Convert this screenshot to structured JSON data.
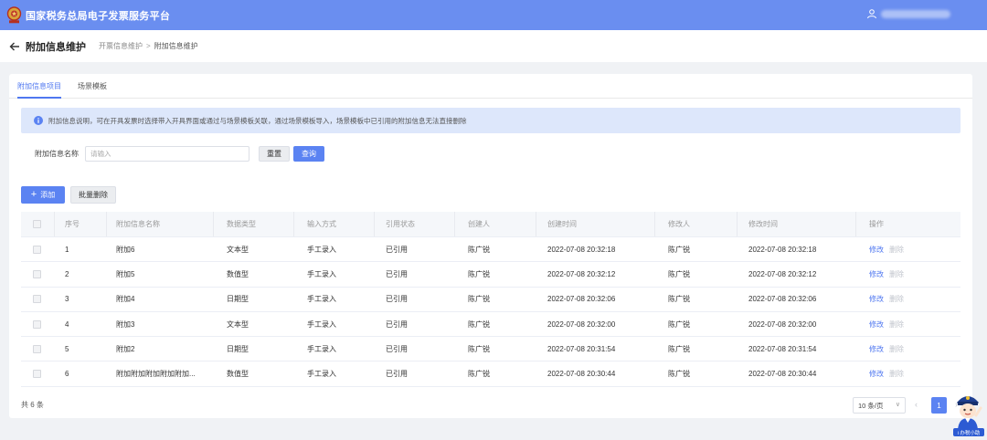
{
  "topbar": {
    "title": "国家税务总局电子发票服务平台"
  },
  "subheader": {
    "page_title": "附加信息维护",
    "breadcrumb": [
      "开票信息维护",
      "附加信息维护"
    ],
    "breadcrumb_sep": ">"
  },
  "tabs": [
    {
      "label": "附加信息项目",
      "active": true
    },
    {
      "label": "场景模板",
      "active": false
    }
  ],
  "notice": {
    "text": "附加信息说明，可在开具发票时选择带入开具界面或通过与场景模板关联，通过场景模板导入，场景模板中已引用的附加信息无法直接删除"
  },
  "search": {
    "label": "附加信息名称",
    "placeholder": "请输入",
    "value": "",
    "reset_label": "重置",
    "query_label": "查询"
  },
  "actions": {
    "add_label": "添加",
    "add_icon": "+",
    "batch_delete_label": "批量删除"
  },
  "table": {
    "headers": {
      "seq": "序号",
      "name": "附加信息名称",
      "type": "数据类型",
      "input": "输入方式",
      "status": "引用状态",
      "creator": "创建人",
      "ctime": "创建时间",
      "modifier": "修改人",
      "mtime": "修改时间",
      "ops": "操作"
    },
    "rows": [
      {
        "seq": "1",
        "name": "附加6",
        "type": "文本型",
        "input": "手工录入",
        "status": "已引用",
        "creator": "陈广锐",
        "ctime": "2022-07-08 20:32:18",
        "modifier": "陈广锐",
        "mtime": "2022-07-08 20:32:18",
        "edit": "修改",
        "del": "删除"
      },
      {
        "seq": "2",
        "name": "附加5",
        "type": "数值型",
        "input": "手工录入",
        "status": "已引用",
        "creator": "陈广锐",
        "ctime": "2022-07-08 20:32:12",
        "modifier": "陈广锐",
        "mtime": "2022-07-08 20:32:12",
        "edit": "修改",
        "del": "删除"
      },
      {
        "seq": "3",
        "name": "附加4",
        "type": "日期型",
        "input": "手工录入",
        "status": "已引用",
        "creator": "陈广锐",
        "ctime": "2022-07-08 20:32:06",
        "modifier": "陈广锐",
        "mtime": "2022-07-08 20:32:06",
        "edit": "修改",
        "del": "删除"
      },
      {
        "seq": "4",
        "name": "附加3",
        "type": "文本型",
        "input": "手工录入",
        "status": "已引用",
        "creator": "陈广锐",
        "ctime": "2022-07-08 20:32:00",
        "modifier": "陈广锐",
        "mtime": "2022-07-08 20:32:00",
        "edit": "修改",
        "del": "删除"
      },
      {
        "seq": "5",
        "name": "附加2",
        "type": "日期型",
        "input": "手工录入",
        "status": "已引用",
        "creator": "陈广锐",
        "ctime": "2022-07-08 20:31:54",
        "modifier": "陈广锐",
        "mtime": "2022-07-08 20:31:54",
        "edit": "修改",
        "del": "删除"
      },
      {
        "seq": "6",
        "name": "附加附加附加附加附加...",
        "type": "数值型",
        "input": "手工录入",
        "status": "已引用",
        "creator": "陈广锐",
        "ctime": "2022-07-08 20:30:44",
        "modifier": "陈广锐",
        "mtime": "2022-07-08 20:30:44",
        "edit": "修改",
        "del": "删除"
      }
    ]
  },
  "footer": {
    "total": "共 6 条",
    "page_size": "10 条/页",
    "current_page": "1"
  },
  "assistant": {
    "label": "i 办税小助"
  },
  "colors": {
    "topbar": "#6a8ef0",
    "primary": "#5b83f2",
    "notice_bg": "#dde7fb",
    "link": "#4f77f0"
  }
}
